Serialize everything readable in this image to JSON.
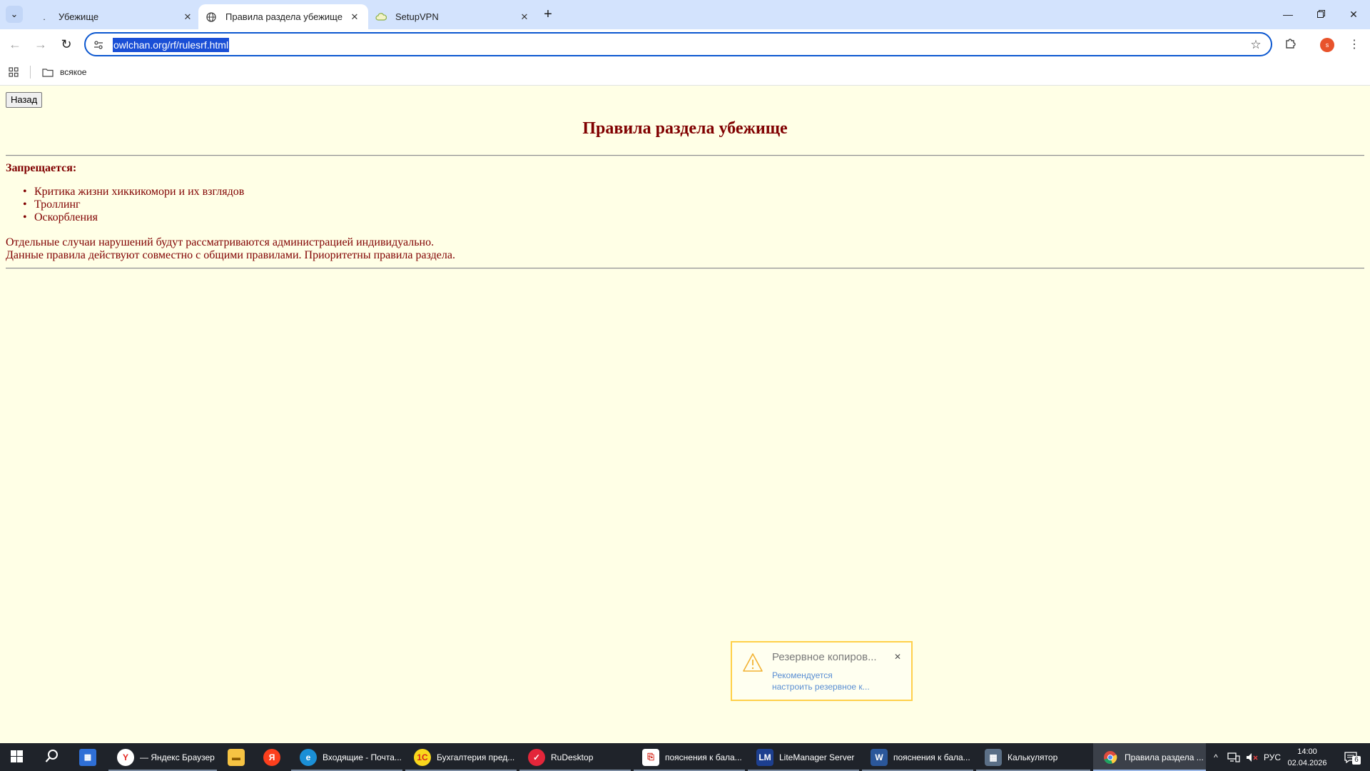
{
  "browser": {
    "tabs": [
      {
        "title": "Убежище",
        "favicon": "dot-icon",
        "active": false
      },
      {
        "title": "Правила раздела убежище",
        "favicon": "globe-icon",
        "active": true
      },
      {
        "title": "SetupVPN",
        "favicon": "cloud-icon",
        "active": false
      }
    ],
    "address": "owlchan.org/rf/rulesrf.html",
    "profile_initial": "s",
    "accent_color": "#0b57d0"
  },
  "bookmarks": {
    "folder_label": "всякое"
  },
  "page": {
    "back_button": "Назад",
    "title": "Правила раздела убежище",
    "forbidden_heading": "Запрещается:",
    "rules": [
      "Критика жизни хиккикомори и их взглядов",
      "Троллинг",
      "Оскорбления"
    ],
    "note_1": "Отдельные случаи нарушений будут рассматриваются администрацией индивидуально.",
    "note_2": "Данные правила действуют совместно с общими правилами. Приоритетны правила раздела.",
    "text_color": "#800000",
    "background_color": "#ffffe6"
  },
  "notification": {
    "title": "Резервное копиров...",
    "text_line_1": "Рекомендуется",
    "text_line_2": "настроить резервное к..."
  },
  "taskbar": {
    "apps": [
      {
        "label": "— Яндекс Браузер",
        "icon": "yandex-browser-icon"
      },
      {
        "label": "",
        "icon": "file-explorer-icon"
      },
      {
        "label": "",
        "icon": "yandex-icon"
      },
      {
        "label": "Входящие - Почта...",
        "icon": "edge-icon"
      },
      {
        "label": "Бухгалтерия пред...",
        "icon": "1c-icon"
      },
      {
        "label": "RuDesktop",
        "icon": "rudesktop-icon"
      },
      {
        "label": "пояснения к бала...",
        "icon": "pdf-icon"
      },
      {
        "label": "LiteManager Server",
        "icon": "litemanager-icon"
      },
      {
        "label": "пояснения к бала...",
        "icon": "word-icon"
      },
      {
        "label": "Калькулятор",
        "icon": "calculator-icon"
      },
      {
        "label": "Правила раздела ...",
        "icon": "chrome-icon"
      }
    ],
    "language": "РУС",
    "time": "14:00",
    "date": "02.04.2026",
    "notification_count": "6"
  }
}
